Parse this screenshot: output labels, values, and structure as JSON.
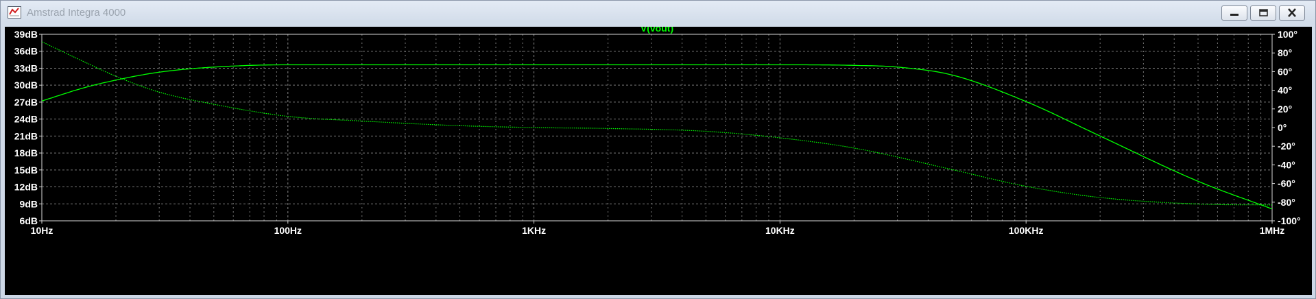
{
  "window": {
    "title": "Amstrad Integra 4000",
    "controls": {
      "minimize": "minimize",
      "maximize": "maximize",
      "close": "close"
    }
  },
  "colors": {
    "background": "#000000",
    "trace": "#00ff00",
    "grid": "#7a7a7a",
    "tick_text": "#ffffff"
  },
  "chart_data": {
    "type": "line",
    "title": "V(vout)",
    "xscale": "log",
    "xlim": [
      10,
      1000000
    ],
    "x_tick_labels": [
      "10Hz",
      "100Hz",
      "1KHz",
      "10KHz",
      "100KHz",
      "1MHz"
    ],
    "ylim_left": [
      6,
      39
    ],
    "y_left_tick_labels": [
      "39dB",
      "36dB",
      "33dB",
      "30dB",
      "27dB",
      "24dB",
      "21dB",
      "18dB",
      "15dB",
      "12dB",
      "9dB",
      "6dB"
    ],
    "ylim_right": [
      -100,
      100
    ],
    "y_right_tick_labels": [
      "100°",
      "80°",
      "60°",
      "40°",
      "20°",
      "0°",
      "-20°",
      "-40°",
      "-60°",
      "-80°",
      "-100°"
    ],
    "grid": true,
    "series": [
      {
        "style": "solid",
        "axis": "left",
        "unit": "dB",
        "x": [
          10,
          15,
          20,
          30,
          50,
          100,
          1000,
          10000,
          20000,
          30000,
          50000,
          100000,
          200000,
          500000,
          1000000
        ],
        "y": [
          27.2,
          29.6,
          30.9,
          32.3,
          33.2,
          33.6,
          33.6,
          33.6,
          33.5,
          33.2,
          31.8,
          27.1,
          21.0,
          13.0,
          8.1
        ]
      },
      {
        "style": "dotted",
        "axis": "right",
        "unit": "°",
        "x": [
          10,
          15,
          20,
          30,
          50,
          100,
          200,
          500,
          1000,
          2000,
          5000,
          10000,
          20000,
          50000,
          100000,
          200000,
          500000,
          1000000
        ],
        "y": [
          92,
          70,
          55,
          38,
          25,
          12,
          7,
          2,
          0,
          -1,
          -4,
          -11,
          -22,
          -45,
          -63,
          -75,
          -82,
          -83
        ]
      }
    ]
  }
}
